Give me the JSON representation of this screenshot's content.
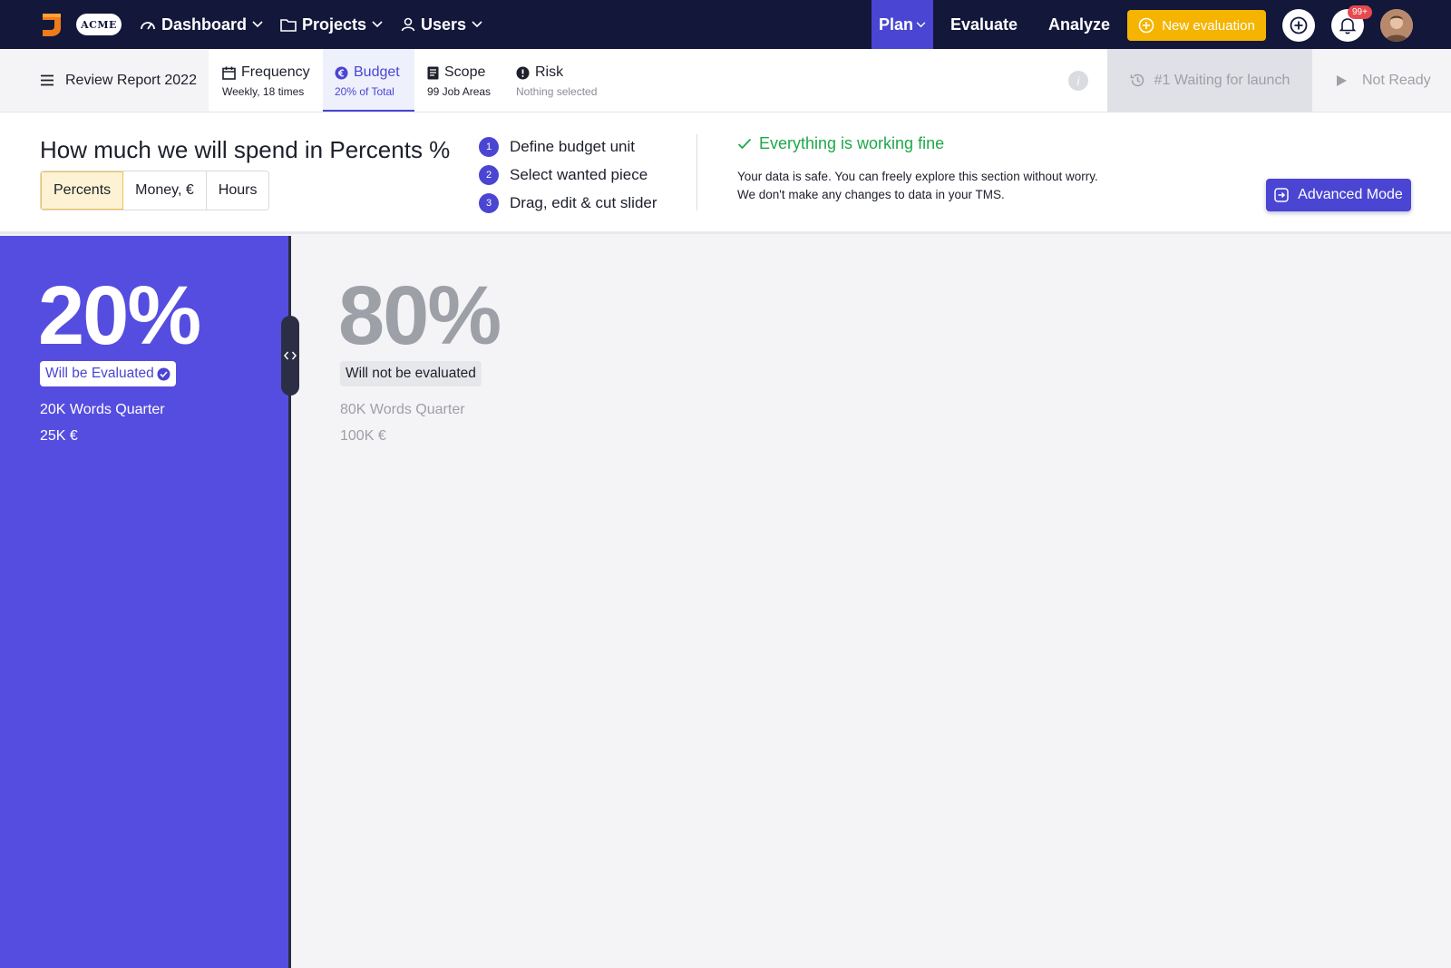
{
  "nav": {
    "brand": "ACME",
    "items": [
      {
        "label": "Dashboard"
      },
      {
        "label": "Projects"
      },
      {
        "label": "Users"
      }
    ],
    "plan_label": "Plan",
    "evaluate_label": "Evaluate",
    "analyze_label": "Analyze",
    "new_eval_label": "New evaluation",
    "notification_count": "99+",
    "accent_color": "#4a45d2",
    "nav_bg": "#13173a",
    "cta_color": "#f5b400"
  },
  "subbar": {
    "report_title": "Review Report 2022",
    "tabs": [
      {
        "title": "Frequency",
        "sub": "Weekly, 18 times",
        "icon": "calendar-icon"
      },
      {
        "title": "Budget",
        "sub": "20% of Total",
        "icon": "euro-icon",
        "active": true
      },
      {
        "title": "Scope",
        "sub": "99 Job Areas",
        "icon": "document-icon"
      },
      {
        "title": "Risk",
        "sub": "Nothing selected",
        "icon": "alert-icon"
      }
    ],
    "waiting_label": "#1 Waiting for launch",
    "not_ready_label": "Not Ready"
  },
  "panel": {
    "title": "How much we will spend in Percents %",
    "units": [
      {
        "label": "Percents",
        "active": true
      },
      {
        "label": "Money, €",
        "active": false
      },
      {
        "label": "Hours",
        "active": false
      }
    ],
    "steps": [
      {
        "num": "1",
        "label": "Define budget unit"
      },
      {
        "num": "2",
        "label": "Select wanted piece"
      },
      {
        "num": "3",
        "label": "Drag, edit & cut slider"
      }
    ],
    "status_title": "Everything is working fine",
    "status_text": "Your data is safe. You can freely explore this section without worry. We don't make any changes to data in your TMS.",
    "advanced_label": "Advanced Mode",
    "success_color": "#1ea84a"
  },
  "slider": {
    "split_fraction": 0.2,
    "left": {
      "percent": "20%",
      "chip": "Will be Evaluated",
      "words": "20K Words Quarter",
      "money": "25K €",
      "color": "#554de0"
    },
    "right": {
      "percent": "80%",
      "chip": "Will not be evaluated",
      "words": "80K Words Quarter",
      "money": "100K €"
    }
  }
}
